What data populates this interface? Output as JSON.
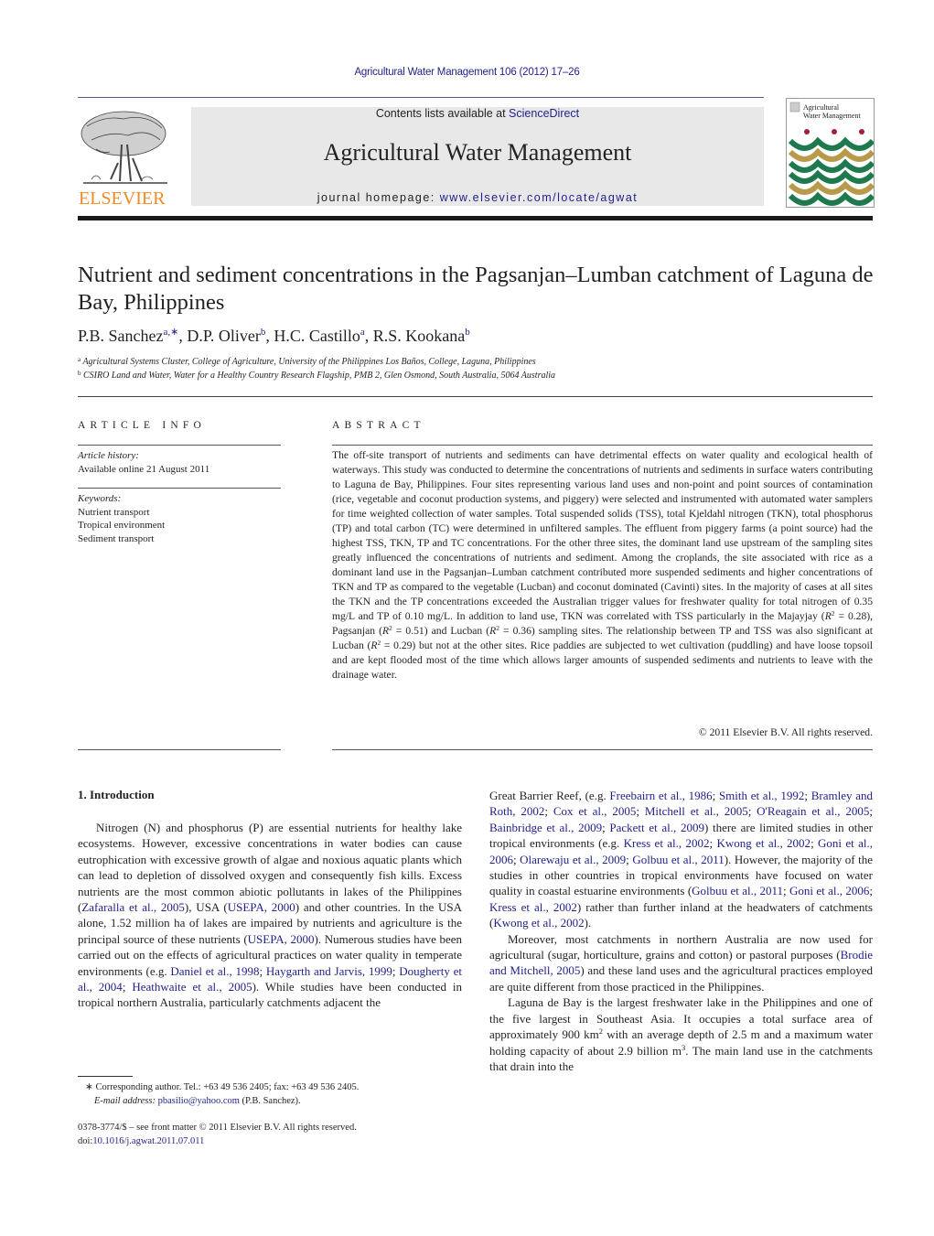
{
  "header": {
    "journal_ref": "Agricultural Water Management 106 (2012) 17–26",
    "contents_prefix": "Contents lists available at ",
    "contents_link": "ScienceDirect",
    "journal_title": "Agricultural Water Management",
    "homepage_prefix": "journal homepage: ",
    "homepage_link": "www.elsevier.com/locate/agwat",
    "publisher_logo_text": "ELSEVIER",
    "cover_title_line1": "Agricultural",
    "cover_title_line2": "Water Management",
    "colors": {
      "link": "#1f1f8a",
      "elsevier_orange": "#f08a24",
      "banner_gray": "#e8e8e9",
      "cover_green": "#1e7a4e",
      "cover_gold": "#b89a4a",
      "cover_red": "#a3203a"
    }
  },
  "article": {
    "title": "Nutrient and sediment concentrations in the Pagsanjan–Lumban catchment of Laguna de Bay, Philippines",
    "authors": [
      {
        "name": "P.B. Sanchez",
        "sup": "a,∗"
      },
      {
        "name": "D.P. Oliver",
        "sup": "b"
      },
      {
        "name": "H.C. Castillo",
        "sup": "a"
      },
      {
        "name": "R.S. Kookana",
        "sup": "b"
      }
    ],
    "affiliations": [
      {
        "mark": "a",
        "text": "Agricultural Systems Cluster, College of Agriculture, University of the Philippines Los Baños, College, Laguna, Philippines"
      },
      {
        "mark": "b",
        "text": "CSIRO Land and Water, Water for a Healthy Country Research Flagship, PMB 2, Glen Osmond, South Australia, 5064 Australia"
      }
    ]
  },
  "article_info": {
    "heading": "ARTICLE INFO",
    "history_label": "Article history:",
    "history_value": "Available online 21 August 2011",
    "keywords_label": "Keywords:",
    "keywords": [
      "Nutrient transport",
      "Tropical environment",
      "Sediment transport"
    ]
  },
  "abstract": {
    "heading": "ABSTRACT",
    "part1": "The off-site transport of nutrients and sediments can have detrimental effects on water quality and ecological health of waterways. This study was conducted to determine the concentrations of nutrients and sediments in surface waters contributing to Laguna de Bay, Philippines. Four sites representing various land uses and non-point and point sources of contamination (rice, vegetable and coconut production systems, and piggery) were selected and instrumented with automated water samplers for time weighted collection of water samples. Total suspended solids (TSS), total Kjeldahl nitrogen (TKN), total phosphorus (TP) and total carbon (TC) were determined in unfiltered samples. The effluent from piggery farms (a point source) had the highest TSS, TKN, TP and TC concentrations. For the other three sites, the dominant land use upstream of the sampling sites greatly influenced the concentrations of nutrients and sediment. Among the croplands, the site associated with rice as a dominant land use in the Pagsanjan–Lumban catchment contributed more suspended sediments and higher concentrations of TKN and TP as compared to the vegetable (Lucban) and coconut dominated (Cavinti) sites. In the majority of cases at all sites the TKN and the TP concentrations exceeded the Australian trigger values for freshwater quality for total nitrogen of 0.35 mg/L and TP of 0.10 mg/L. In addition to land use, TKN was correlated with TSS particularly in the Majayjay (",
    "r2_majayjay": " = 0.28), Pagsanjan (",
    "r2_pagsanjan": " = 0.51) and Lucban (",
    "r2_lucban": " = 0.36) sampling sites. The relationship between TP and TSS was also significant at Lucban (",
    "part_end": " = 0.29) but not at the other sites. Rice paddies are subjected to wet cultivation (puddling) and have loose topsoil and are kept flooded most of the time which allows larger amounts of suspended sediments and nutrients to leave with the drainage water.",
    "r_symbol": "R",
    "r_exp": "2",
    "copyright": "© 2011 Elsevier B.V. All rights reserved."
  },
  "introduction": {
    "heading": "1.  Introduction",
    "left_p1_a": "Nitrogen (N) and phosphorus (P) are essential nutrients for healthy lake ecosystems. However, excessive concentrations in water bodies can cause eutrophication with excessive growth of algae and noxious aquatic plants which can lead to depletion of dissolved oxygen and consequently fish kills. Excess nutrients are the most common abiotic pollutants in lakes of the Philippines (",
    "cite_zafaralla": "Zafaralla et al., 2005",
    "left_p1_b": "), USA (",
    "cite_usepa1": "USEPA, 2000",
    "left_p1_c": ") and other countries. In the USA alone, 1.52 million ha of lakes are impaired by nutrients and agriculture is the principal source of these nutrients (",
    "cite_usepa2": "USEPA, 2000",
    "left_p1_d": "). Numerous studies have been carried out on the effects of agricultural practices on water quality in temperate environments (e.g. ",
    "cite_daniel": "Daniel et al., 1998",
    "cite_haygarth": "Haygarth and Jarvis, 1999",
    "cite_dougherty": "Dougherty et al., 2004",
    "cite_heathwaite": "Heathwaite et al., 2005",
    "sep": "; ",
    "left_p1_e": "). While studies have been conducted in tropical northern Australia, particularly catchments adjacent the",
    "right_p1_a": "Great Barrier Reef, (e.g. ",
    "cite_freebairn": "Freebairn et al., 1986",
    "cite_smith": "Smith et al., 1992",
    "cite_bramley": "Bramley and Roth, 2002",
    "cite_cox": "Cox et al., 2005",
    "cite_mitchell": "Mitchell et al., 2005",
    "cite_oreagain": "O'Reagain et al., 2005",
    "cite_bainbridge": "Bainbridge et al., 2009",
    "cite_packett": "Packett et al., 2009",
    "right_p1_b": ") there are limited studies in other tropical environments (e.g. ",
    "cite_kress1": "Kress et al., 2002",
    "cite_kwong1": "Kwong et al., 2002",
    "cite_goni1": "Goni et al., 2006",
    "cite_olarewaju": "Olarewaju et al., 2009",
    "cite_golbuu1": "Golbuu et al., 2011",
    "right_p1_c": "). However, the majority of the studies in other countries in tropical environments have focused on water quality in coastal estuarine environments (",
    "cite_golbuu2": "Golbuu et al., 2011",
    "cite_goni2": "Goni et al., 2006",
    "cite_kress2": "Kress et al., 2002",
    "right_p1_d": ") rather than further inland at the headwaters of catchments (",
    "cite_kwong2": "Kwong et al., 2002",
    "right_p1_e": ").",
    "right_p2_a": "Moreover, most catchments in northern Australia are now used for agricultural (sugar, horticulture, grains and cotton) or pastoral purposes (",
    "cite_brodie": "Brodie and Mitchell, 2005",
    "right_p2_b": ") and these land uses and the agricultural practices employed are quite different from those practiced in the Philippines.",
    "right_p3_a": "Laguna de Bay is the largest freshwater lake in the Philippines and one of the five largest in Southeast Asia. It occupies a total surface area of approximately 900 km",
    "sup2": "2",
    "right_p3_b": " with an average depth of 2.5 m and a maximum water holding capacity of about 2.9 billion m",
    "sup3": "3",
    "right_p3_c": ". The main land use in the catchments that drain into the"
  },
  "footnote": {
    "marker": "∗",
    "corresponding": " Corresponding author. Tel.: +63 49 536 2405; fax: +63 49 536 2405.",
    "email_label": "E-mail address:",
    "email": "pbasilio@yahoo.com",
    "email_suffix": " (P.B. Sanchez).",
    "issn_line": "0378-3774/$ – see front matter © 2011 Elsevier B.V. All rights reserved.",
    "doi_prefix": "doi:",
    "doi": "10.1016/j.agwat.2011.07.011"
  }
}
